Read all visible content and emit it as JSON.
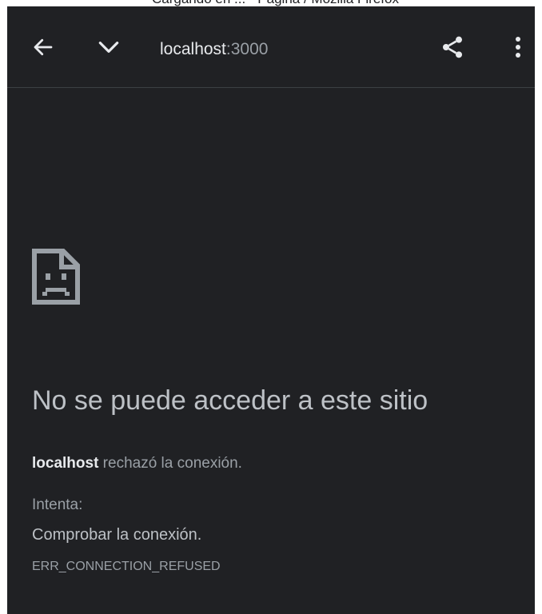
{
  "clipped_caption": "Cargando en ... - Página / Mozilla Firefox",
  "toolbar": {
    "back_icon": "arrow-left-icon",
    "expand_icon": "chevron-down-icon",
    "url_host": "localhost",
    "url_port": ":3000",
    "share_icon": "share-icon",
    "menu_icon": "vertical-dots-icon"
  },
  "error_page": {
    "icon": "sad-page-icon",
    "headline": "No se puede acceder a este sitio",
    "message_host": "localhost",
    "message_rest": " rechazó la conexión.",
    "try_label": "Intenta:",
    "suggestion": "Comprobar la conexión.",
    "error_code": "ERR_CONNECTION_REFUSED"
  },
  "colors": {
    "background": "#202124",
    "text_primary": "#e8eaed",
    "text_secondary": "#9aa0a6",
    "headline": "#bdc1c6",
    "divider": "#3c4043"
  }
}
